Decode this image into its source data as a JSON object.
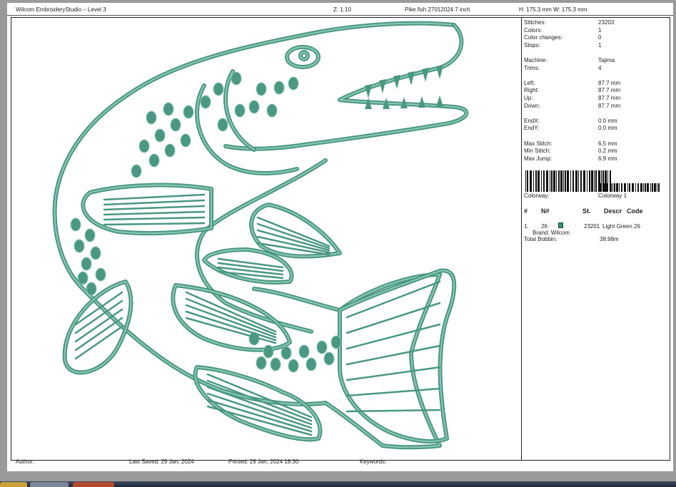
{
  "header": {
    "app": "Wilcom EmbroideryStudio – Level 3",
    "zoom": "Z: 1:10",
    "design_name": "Pike fish 27012024 7  inch",
    "size": "H: 175.3 mm   W: 175.3 mm"
  },
  "stats": {
    "stitches_label": "Stitches:",
    "stitches": "23203",
    "colors_label": "Colors:",
    "colors": "1",
    "color_changes_label": "Color changes:",
    "color_changes": "0",
    "stops_label": "Stops:",
    "stops": "1",
    "machine_label": "Machine:",
    "machine": "Tajima",
    "trims_label": "Trims:",
    "trims": "4",
    "left_label": "Left:",
    "left": "87.7 mm",
    "right_label": "Right:",
    "right": "87.7 mm",
    "up_label": "Up:",
    "up": "87.7 mm",
    "down_label": "Down:",
    "down": "87.7 mm",
    "endx_label": "EndX:",
    "endx": "0.0 mm",
    "endy_label": "EndY:",
    "endy": "0.0 mm",
    "max_stitch_label": "Max Stitch:",
    "max_stitch": "6.5 mm",
    "min_stitch_label": "Min Stitch:",
    "min_stitch": "0.2 mm",
    "max_jump_label": "Max Jump:",
    "max_jump": "6.9 mm"
  },
  "colorway": {
    "label": "Colorway:",
    "value": "Colorway 1"
  },
  "color_table": {
    "headers": [
      "#",
      "N#",
      "St.",
      "Descr",
      "Code"
    ],
    "rows": [
      {
        "index": "1.",
        "number": "26",
        "swatch_color": "#3f8f77",
        "stitches": "23201",
        "description": "Light Green 26",
        "brand": "Brand: Wilcom"
      }
    ],
    "total_bobbin_label": "Total Bobbin:",
    "total_bobbin": "38.98m"
  },
  "footer": {
    "author": "Author:",
    "last_saved": "Last Saved: 29 Jan, 2024",
    "printed": "Printed:  29 Jan, 2024 18:30",
    "keywords": "Keywords:"
  },
  "thread_color": "#4a9782",
  "thread_highlight": "#8cc8b6"
}
